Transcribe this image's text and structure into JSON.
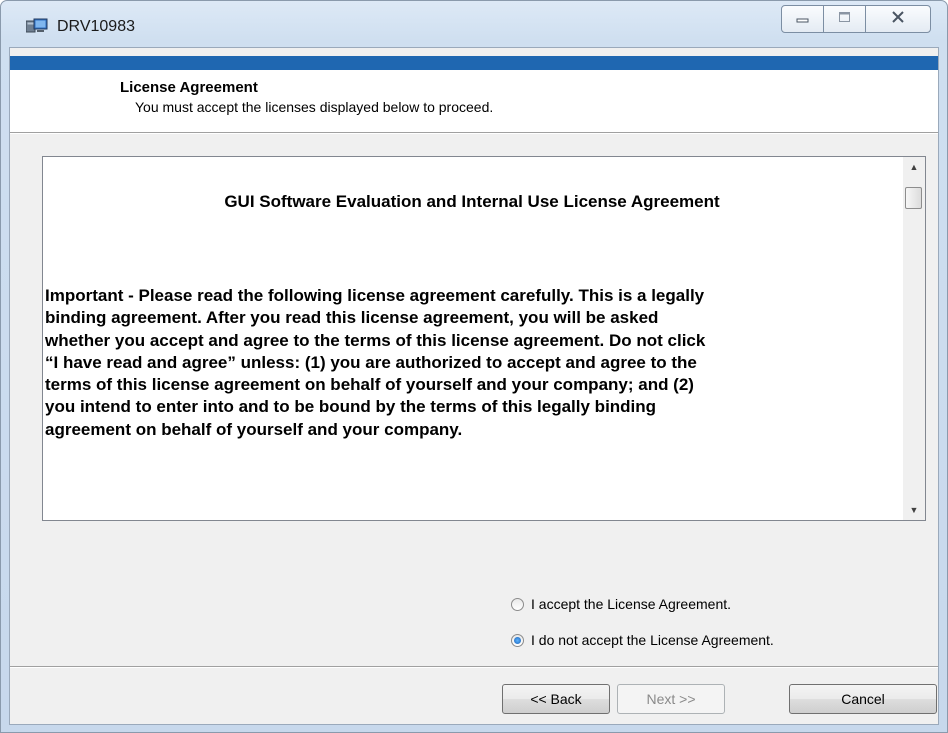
{
  "window": {
    "title": "DRV10983",
    "icons": {
      "app": "installer-computer-icon",
      "minimize": "minimize-icon",
      "maximize": "maximize-icon",
      "close": "close-icon"
    }
  },
  "header": {
    "title": "License Agreement",
    "subtitle": "You must accept the licenses displayed below to proceed."
  },
  "license": {
    "heading": "GUI Software Evaluation and Internal Use License Agreement",
    "body_lines": [
      "Important - Please read the following license agreement carefully.  This is a legally",
      "binding agreement.  After you read this license agreement, you will be asked",
      "whether you accept and agree to the terms of this license agreement.  Do not click",
      "“I have read and agree” unless: (1) you are authorized to accept and agree to the",
      "terms of this license agreement on behalf of yourself and your company; and (2)",
      "you intend to enter into and to be bound by the terms of this legally binding",
      "agreement on behalf of yourself and your company."
    ]
  },
  "options": {
    "accept_label": "I accept the License Agreement.",
    "decline_label": "I do not accept the License Agreement.",
    "selected": "decline"
  },
  "buttons": {
    "back": "<< Back",
    "next": "Next >>",
    "cancel": "Cancel"
  },
  "colors": {
    "header_band": "#1f67b1",
    "dialog_bg": "#f0f0f0"
  }
}
